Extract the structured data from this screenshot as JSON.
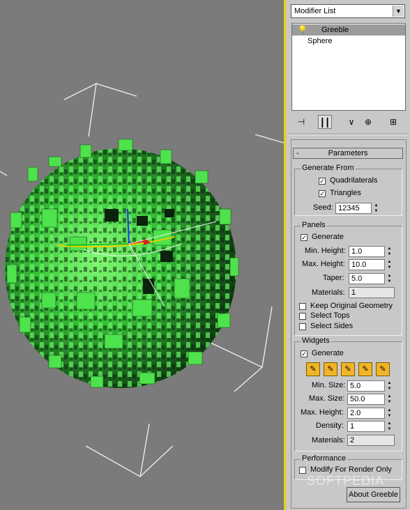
{
  "modifier_list": {
    "label": "Modifier List",
    "arrow": "▼"
  },
  "stack": {
    "items": [
      {
        "label": "Greeble",
        "icon": "light-bulb-icon"
      },
      {
        "label": "Sphere"
      }
    ]
  },
  "parameters": {
    "title": "Parameters",
    "collapse": "-",
    "generate_from": {
      "title": "Generate From",
      "quadrilaterals": {
        "label": "Quadrilaterals",
        "checked": "✓"
      },
      "triangles": {
        "label": "Triangles",
        "checked": "✓"
      },
      "seed": {
        "label": "Seed:",
        "value": "12345"
      }
    },
    "panels": {
      "title": "Panels",
      "generate": {
        "label": "Generate",
        "checked": "✓"
      },
      "min_height": {
        "label": "Min. Height:",
        "value": "1.0"
      },
      "max_height": {
        "label": "Max. Height:",
        "value": "10.0"
      },
      "taper": {
        "label": "Taper:",
        "value": "5.0"
      },
      "materials": {
        "label": "Materials:",
        "value": "1"
      },
      "keep_original": {
        "label": "Keep Original Geometry"
      },
      "select_tops": {
        "label": "Select Tops"
      },
      "select_sides": {
        "label": "Select Sides"
      }
    },
    "widgets": {
      "title": "Widgets",
      "generate": {
        "label": "Generate",
        "checked": "✓"
      },
      "min_size": {
        "label": "Min. Size:",
        "value": "5.0"
      },
      "max_size": {
        "label": "Max. Size:",
        "value": "50.0"
      },
      "max_height": {
        "label": "Max. Height:",
        "value": "2.0"
      },
      "density": {
        "label": "Density:",
        "value": "1"
      },
      "materials": {
        "label": "Materials:",
        "value": "2"
      }
    },
    "performance": {
      "title": "Performance",
      "modify_for_render": {
        "label": "Modify For Render Only"
      }
    },
    "about": "About Greeble"
  },
  "watermark": "SOFTPEDIA",
  "colors": {
    "viewport": "#7b7b7b",
    "accent_yellow": "#e8d000",
    "panel": "#c8c8c8",
    "greeble_green": "#3fd24a"
  }
}
